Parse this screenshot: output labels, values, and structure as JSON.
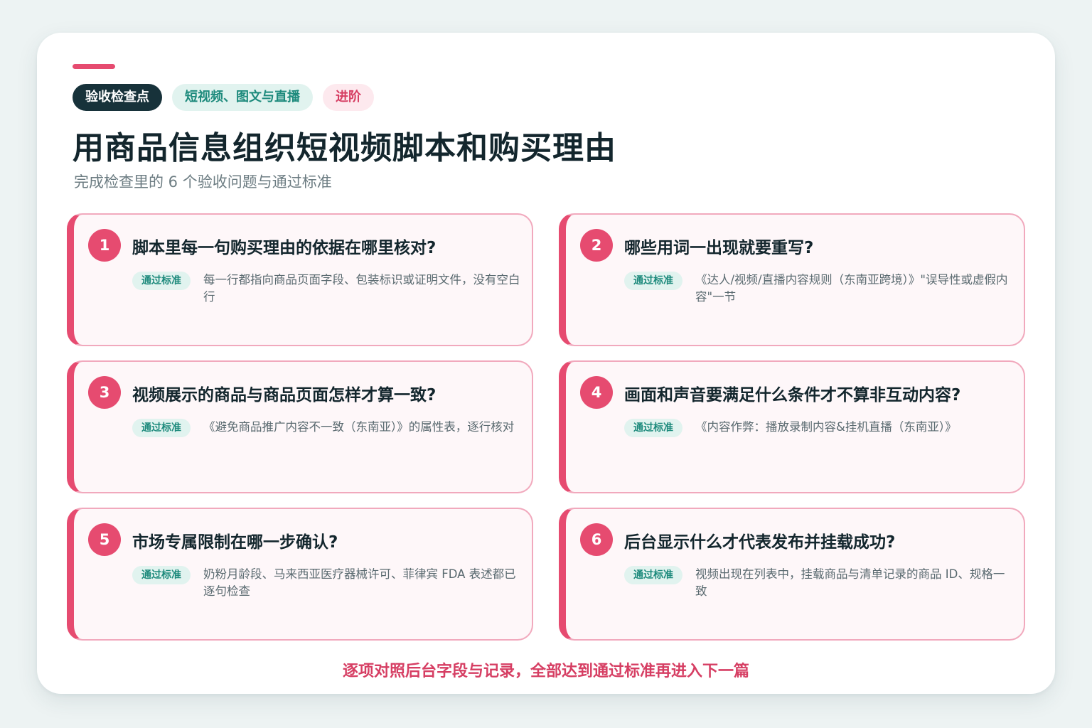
{
  "tags": [
    "验收检查点",
    "短视频、图文与直播",
    "进阶"
  ],
  "title": "用商品信息组织短视频脚本和购买理由",
  "subtitle": "完成检查里的 6 个验收问题与通过标准",
  "items": [
    {
      "number": "1",
      "question": "脚本里每一句购买理由的依据在哪里核对?",
      "badge": "通过标准",
      "answer": "每一行都指向商品页面字段、包装标识或证明文件，没有空白行"
    },
    {
      "number": "2",
      "question": "哪些用词一出现就要重写?",
      "badge": "通过标准",
      "answer": "《达人/视频/直播内容规则（东南亚跨境）》\"误导性或虚假内容\"一节"
    },
    {
      "number": "3",
      "question": "视频展示的商品与商品页面怎样才算一致?",
      "badge": "通过标准",
      "answer": "《避免商品推广内容不一致（东南亚）》的属性表，逐行核对"
    },
    {
      "number": "4",
      "question": "画面和声音要满足什么条件才不算非互动内容?",
      "badge": "通过标准",
      "answer": "《内容作弊：播放录制内容&挂机直播（东南亚）》"
    },
    {
      "number": "5",
      "question": "市场专属限制在哪一步确认?",
      "badge": "通过标准",
      "answer": "奶粉月龄段、马来西亚医疗器械许可、菲律宾 FDA 表述都已逐句检查"
    },
    {
      "number": "6",
      "question": "后台显示什么才代表发布并挂载成功?",
      "badge": "通过标准",
      "answer": "视频出现在列表中，挂载商品与清单记录的商品 ID、规格一致"
    }
  ],
  "footer": "逐项对照后台字段与记录，全部达到通过标准再进入下一篇",
  "colors": {
    "accent": "#e64b70",
    "dark": "#17323a",
    "teal": "#1d8a7c",
    "teal_bg": "#e1f3ef",
    "card_bg": "#fef7f9"
  }
}
